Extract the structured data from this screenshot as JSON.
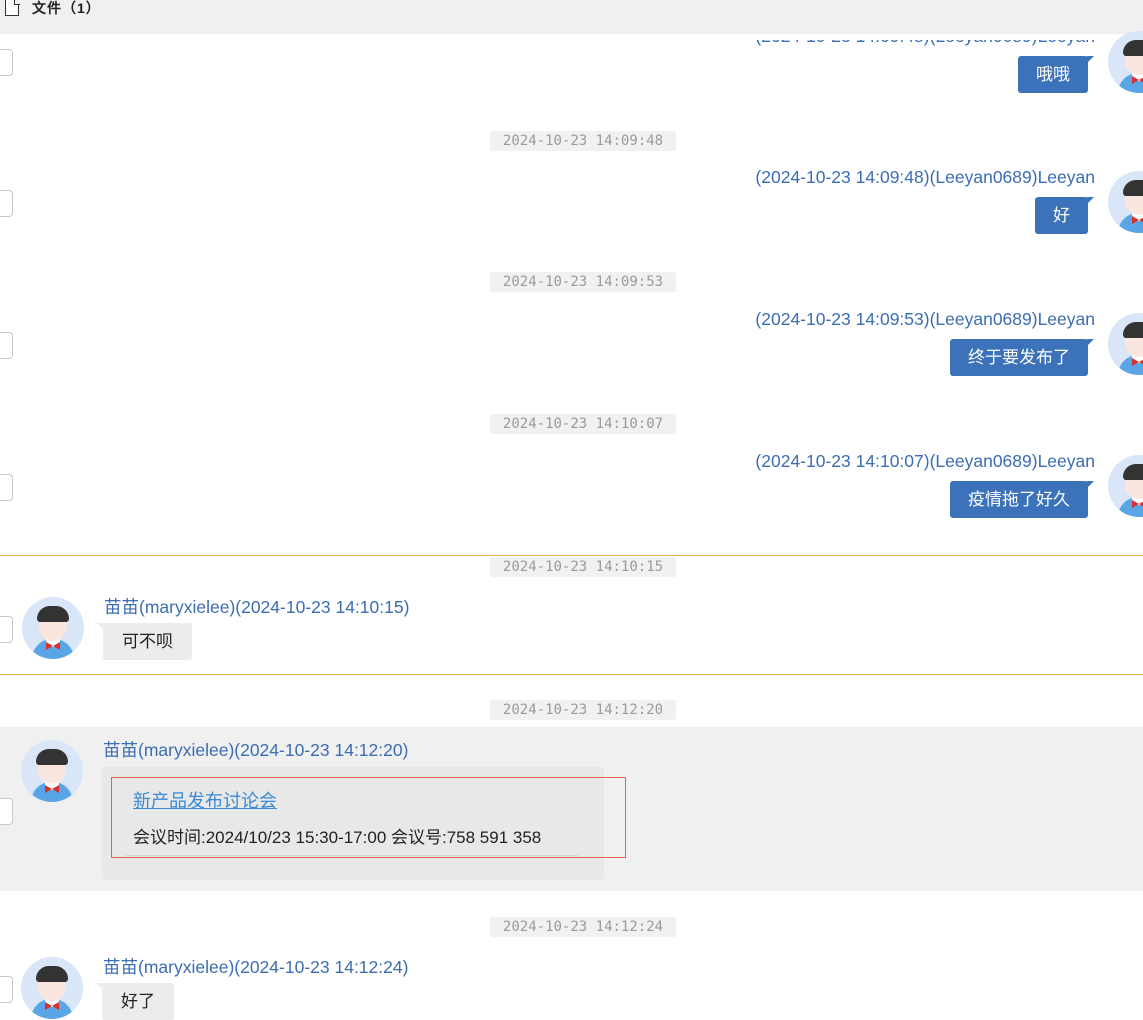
{
  "toolbar": {
    "files_label": "文件（1）"
  },
  "messages": {
    "m0": {
      "text": "哦哦"
    },
    "m1": {
      "time": "2024-10-23 14:09:48",
      "sender": "(2024-10-23 14:09:48)(Leeyan0689)Leeyan",
      "text": "好"
    },
    "m2": {
      "time": "2024-10-23 14:09:53",
      "sender": "(2024-10-23 14:09:53)(Leeyan0689)Leeyan",
      "text": "终于要发布了"
    },
    "m3": {
      "time": "2024-10-23 14:10:07",
      "sender": "(2024-10-23 14:10:07)(Leeyan0689)Leeyan",
      "text": "疫情拖了好久"
    },
    "m4": {
      "time": "2024-10-23 14:10:15",
      "sender": "苗苗(maryxielee)(2024-10-23 14:10:15)",
      "text": "可不呗"
    },
    "m5": {
      "time": "2024-10-23 14:12:20",
      "sender": "苗苗(maryxielee)(2024-10-23 14:12:20)",
      "card_title": "新产品发布讨论会",
      "card_info": "会议时间:2024/10/23 15:30-17:00 会议号:758 591 358"
    },
    "m6": {
      "time": "2024-10-23 14:12:24",
      "sender": "苗苗(maryxielee)(2024-10-23 14:12:24)",
      "text": "好了"
    }
  },
  "colors": {
    "self_bubble": "#3b72b9",
    "other_bubble": "#ececec",
    "sender_name": "#3b6db3",
    "divider": "#e6b04a",
    "highlight_border": "#e8604f",
    "link": "#3a8ad6"
  }
}
